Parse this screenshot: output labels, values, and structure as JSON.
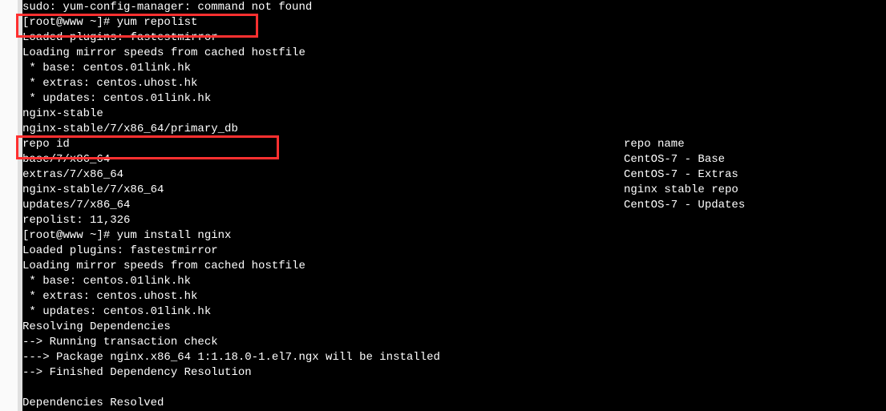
{
  "terminal": {
    "lines": [
      "sudo: yum-config-manager: command not found",
      "[root@www ~]# yum repolist",
      "Loaded plugins: fastestmirror",
      "Loading mirror speeds from cached hostfile",
      " * base: centos.01link.hk",
      " * extras: centos.uhost.hk",
      " * updates: centos.01link.hk",
      "nginx-stable",
      "nginx-stable/7/x86_64/primary_db",
      "repo id",
      "base/7/x86_64",
      "extras/7/x86_64",
      "nginx-stable/7/x86_64",
      "updates/7/x86_64",
      "repolist: 11,326",
      "[root@www ~]# yum install nginx",
      "Loaded plugins: fastestmirror",
      "Loading mirror speeds from cached hostfile",
      " * base: centos.01link.hk",
      " * extras: centos.uhost.hk",
      " * updates: centos.01link.hk",
      "Resolving Dependencies",
      "--> Running transaction check",
      "---> Package nginx.x86_64 1:1.18.0-1.el7.ngx will be installed",
      "--> Finished Dependency Resolution",
      "",
      "Dependencies Resolved"
    ],
    "repo_header_name": "repo name",
    "repo_names": [
      "CentOS-7 - Base",
      "CentOS-7 - Extras",
      "nginx stable repo",
      "CentOS-7 - Updates"
    ]
  }
}
